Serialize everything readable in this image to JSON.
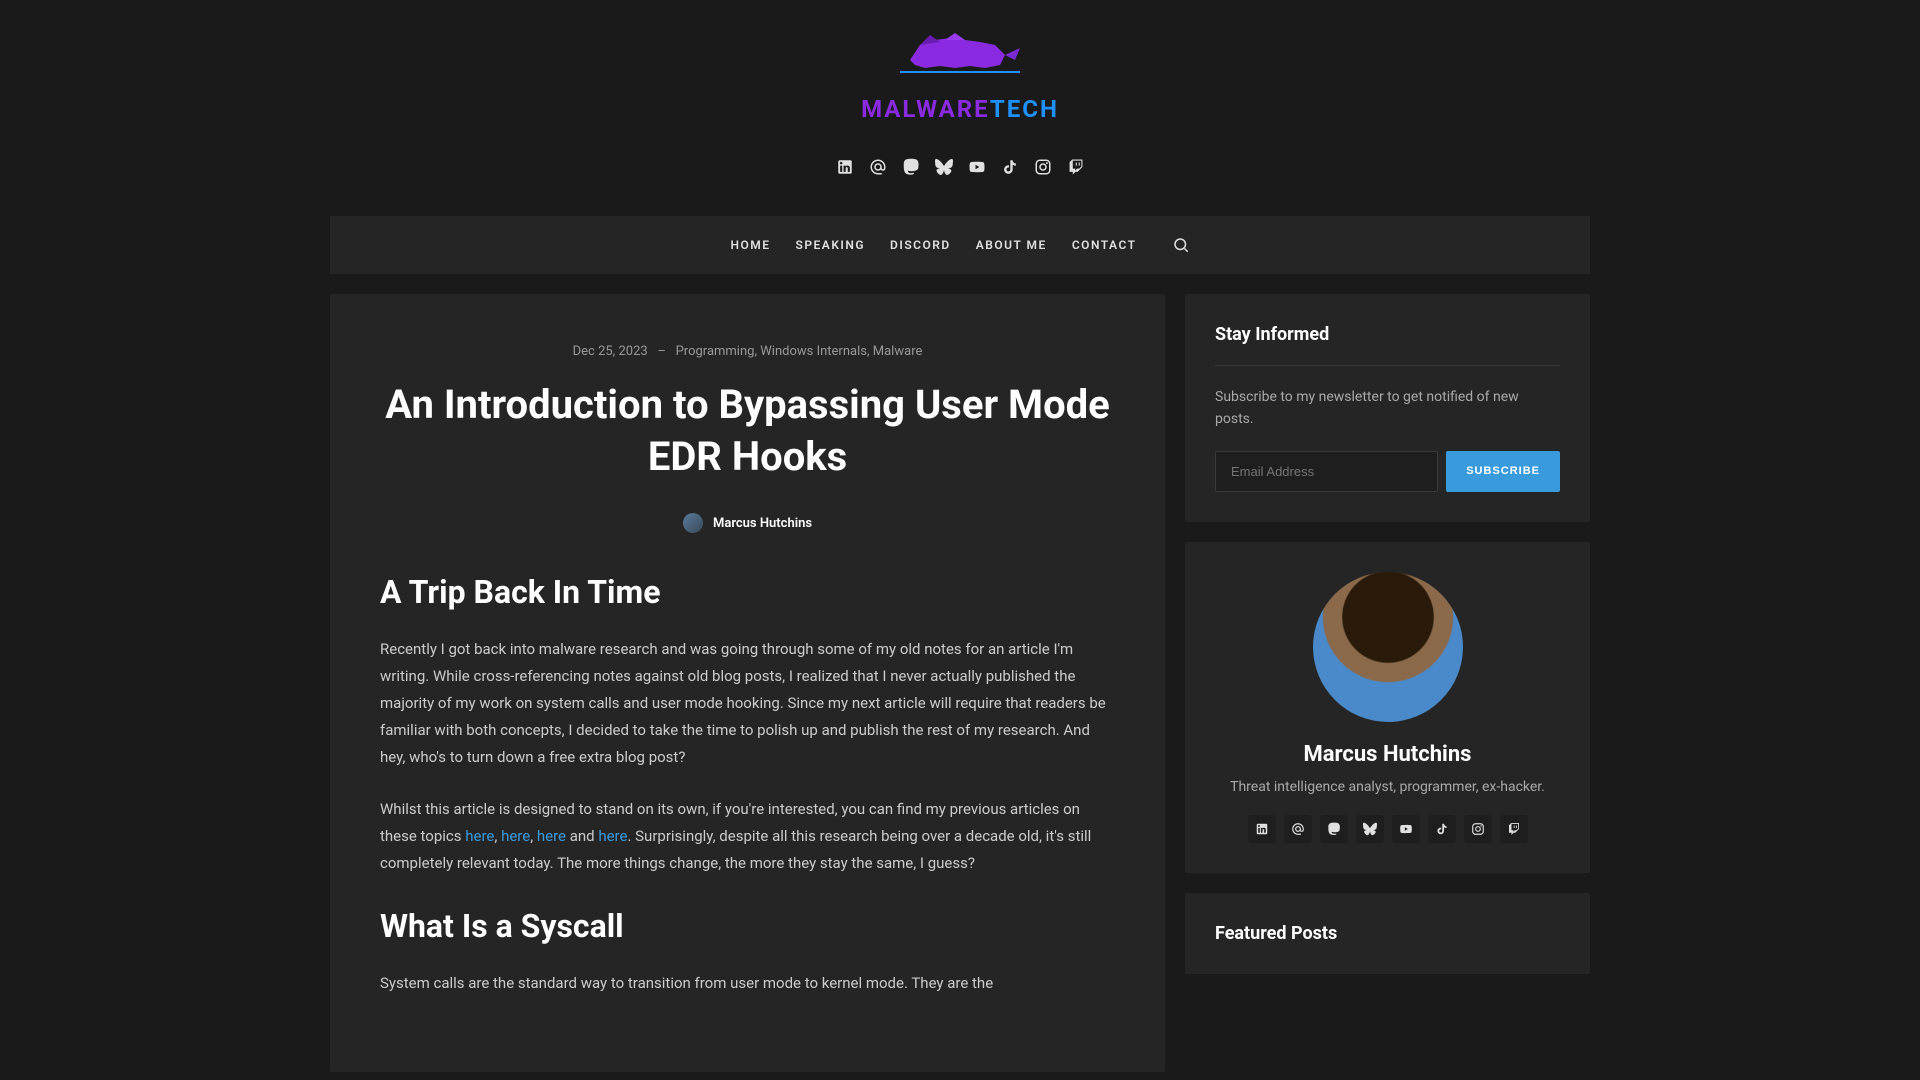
{
  "site": {
    "name_part1": "MALWARE",
    "name_part2": "TECH"
  },
  "nav": {
    "items": [
      "HOME",
      "SPEAKING",
      "DISCORD",
      "ABOUT ME",
      "CONTACT"
    ]
  },
  "article": {
    "date": "Dec 25, 2023",
    "separator": "–",
    "categories": [
      "Programming",
      "Windows Internals",
      "Malware"
    ],
    "title": "An Introduction to Bypassing User Mode EDR Hooks",
    "author": "Marcus Hutchins",
    "heading1": "A Trip Back In Time",
    "para1": "Recently I got back into malware research and was going through some of my old notes for an article I'm writing. While cross-referencing notes against old blog posts, I realized that I never actually published the majority of my work on system calls and user mode hooking. Since my next article will require that readers be familiar with both concepts, I decided to take the time to polish up and publish the rest of my research. And hey, who's to turn down a free extra blog post?",
    "para2_start": "Whilst this article is designed to stand on its own, if you're interested, you can find my previous articles on these topics ",
    "link_here": "here",
    "para2_c1": ", ",
    "para2_c2": ", ",
    "para2_and": " and ",
    "para2_end": ". Surprisingly, despite all this research being over a decade old, it's still completely relevant today. The more things change, the more they stay the same, I guess?",
    "heading2": "What Is a Syscall",
    "para3": "System calls are the standard way to transition from user mode to kernel mode. They are the"
  },
  "sidebar": {
    "stay_informed": {
      "heading": "Stay Informed",
      "text": "Subscribe to my newsletter to get notified of new posts.",
      "email_placeholder": "Email Address",
      "button": "SUBSCRIBE"
    },
    "profile": {
      "name": "Marcus Hutchins",
      "bio": "Threat intelligence analyst, programmer, ex-hacker."
    },
    "featured": {
      "heading": "Featured Posts"
    }
  }
}
